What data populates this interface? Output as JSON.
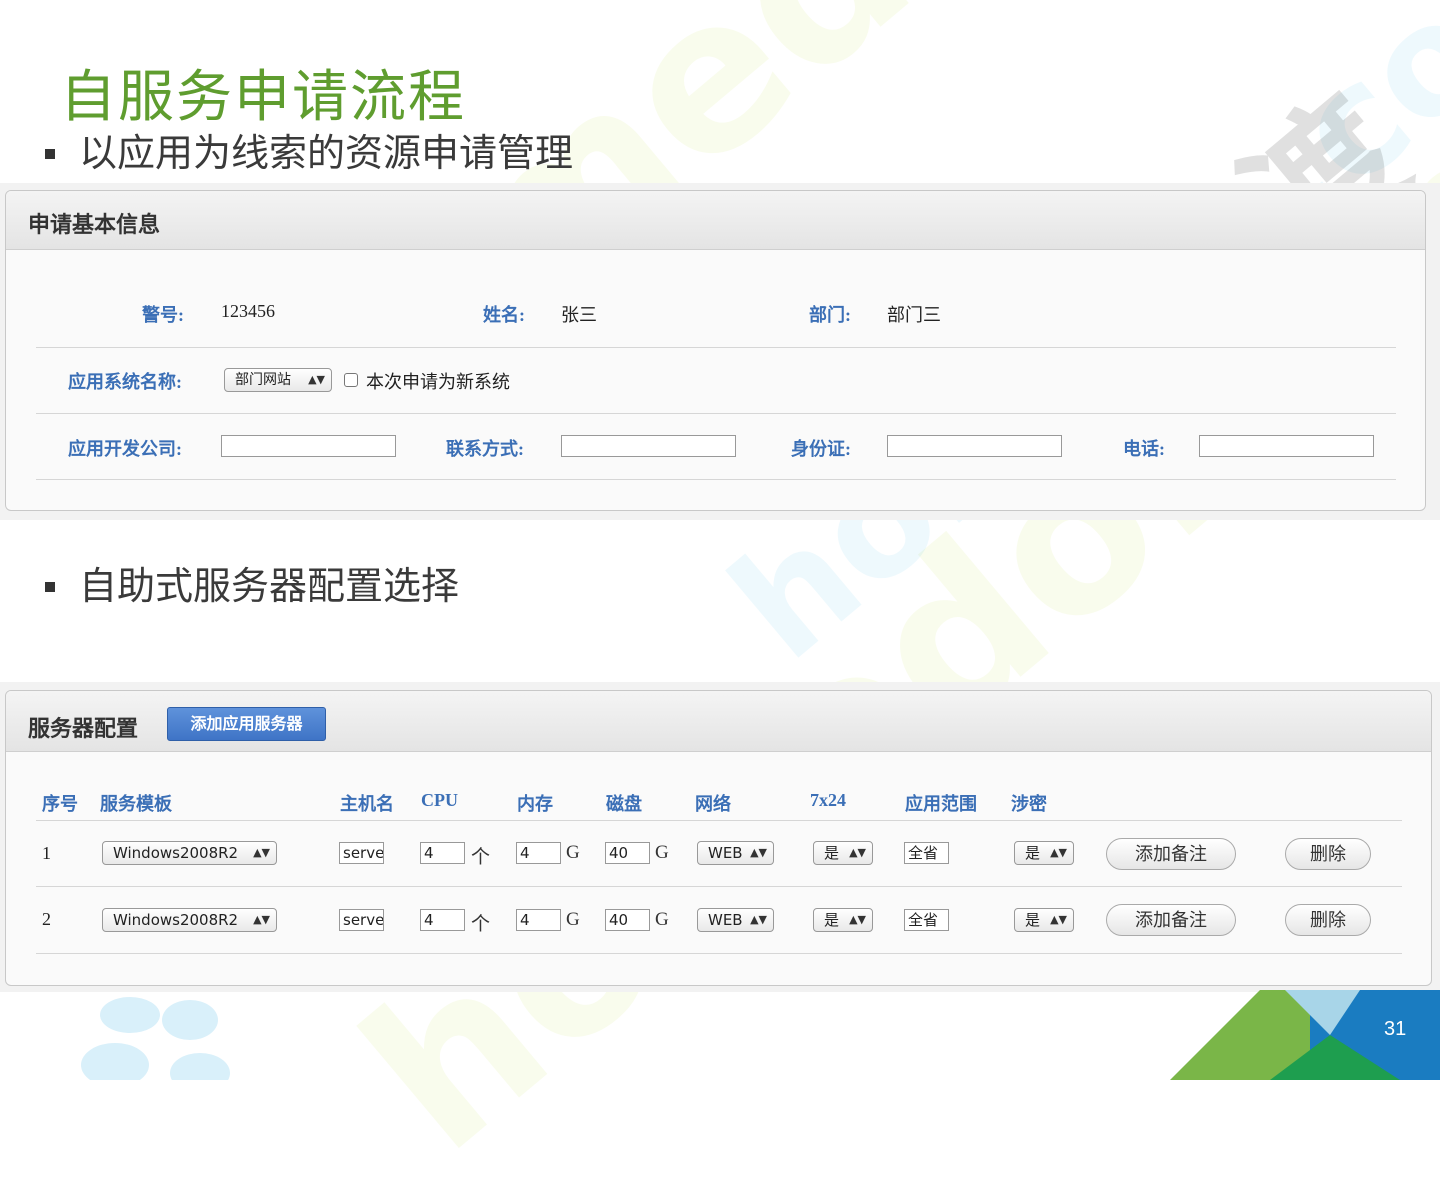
{
  "slide": {
    "title": "自服务申请流程",
    "bullet1": "以应用为线索的资源申请管理",
    "bullet2": "自助式服务器配置选择",
    "page_number": "31",
    "watermark": "homedo.com",
    "watermark_cn": "河姆渡"
  },
  "basic_info": {
    "title": "申请基本信息",
    "badge_label": "警号:",
    "badge_value": "123456",
    "name_label": "姓名:",
    "name_value": "张三",
    "dept_label": "部门:",
    "dept_value": "部门三",
    "app_name_label": "应用系统名称:",
    "app_name_selected": "部门网站",
    "new_system_label": "本次申请为新系统",
    "dev_company_label": "应用开发公司:",
    "contact_label": "联系方式:",
    "id_card_label": "身份证:",
    "phone_label": "电话:"
  },
  "server_config": {
    "title": "服务器配置",
    "add_button": "添加应用服务器",
    "headers": {
      "index": "序号",
      "template": "服务模板",
      "hostname": "主机名",
      "cpu": "CPU",
      "memory": "内存",
      "disk": "磁盘",
      "network": "网络",
      "hours": "7x24",
      "scope": "应用范围",
      "classified": "涉密"
    },
    "units": {
      "cpu": "个",
      "memory": "G",
      "disk": "G"
    },
    "rows": [
      {
        "index": "1",
        "template": "Windows2008R2",
        "hostname": "serve",
        "cpu": "4",
        "memory": "4",
        "disk": "40",
        "network": "WEB",
        "hours": "是",
        "scope": "全省",
        "classified": "是",
        "note_button": "添加备注",
        "delete_button": "删除"
      },
      {
        "index": "2",
        "template": "Windows2008R2",
        "hostname": "serve",
        "cpu": "4",
        "memory": "4",
        "disk": "40",
        "network": "WEB",
        "hours": "是",
        "scope": "全省",
        "classified": "是",
        "note_button": "添加备注",
        "delete_button": "删除"
      }
    ]
  },
  "colors": {
    "title_green": "#5f9d2f",
    "label_blue": "#3b6fb6",
    "button_blue": "#4a80d0"
  },
  "icons": {
    "select_arrow": "select-arrow-icon",
    "checkbox": "checkbox-icon",
    "logo_flower": "flower-logo-icon"
  }
}
